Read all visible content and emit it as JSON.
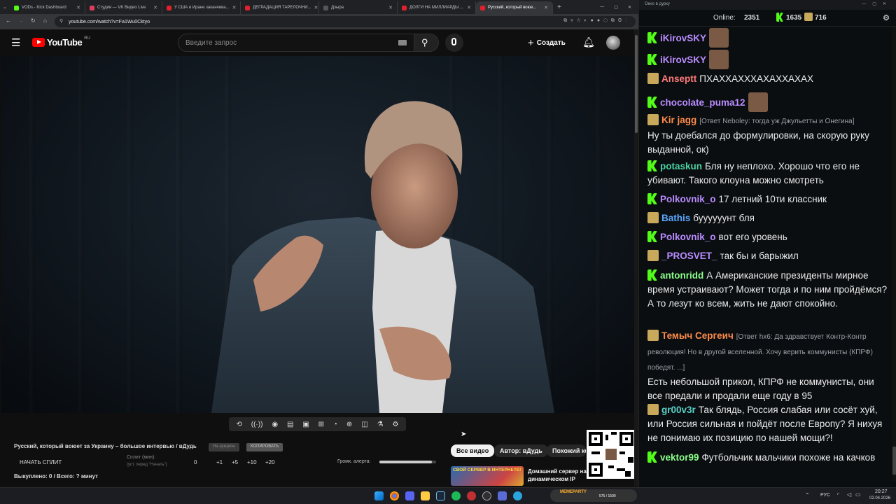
{
  "browser": {
    "tabs": [
      {
        "label": "VODs - Kick Dashboard",
        "color": "#53fc18"
      },
      {
        "label": "Студия — VK Видео Live",
        "color": "#e03c5c"
      },
      {
        "label": "У США в Иране заканчива...",
        "color": "#e0202c"
      },
      {
        "label": "ДЕГРАДАЦИЯ ТАРЕЛОЧНИ...",
        "color": "#e0202c"
      },
      {
        "label": "Дзыра",
        "color": "#555555"
      },
      {
        "label": "ДОЛГИ НА МИЛЛИАРДЫ ...",
        "color": "#e0202c"
      },
      {
        "label": "Русский, который воюе...",
        "color": "#e0202c"
      }
    ],
    "new_tab": "+",
    "url": "youtube.com/watch?v=Fa1Wu0Cktyo"
  },
  "youtube": {
    "logo_text": "YouTube",
    "logo_region": "RU",
    "search_placeholder": "Введите запрос",
    "create_label": "Создать"
  },
  "controls": {
    "video_title": "Русский, который воюет за Украину – большое интервью / вДудь",
    "btn_on_auction": "На аукцион",
    "btn_copy": "КОПИРОВАТЬ",
    "start_split": "НАЧАТЬ СПЛИТ",
    "split_label": "Сплит (мин):",
    "split_hint": "(уст. перед \"Начать\")",
    "split_value": "0",
    "increments": [
      "+1",
      "+5",
      "+10",
      "+20"
    ],
    "alert_volume_label": "Громк. алерта:",
    "alert_volume": 0.92,
    "bought": "Выкуплено: 0 / Всего: ? минут",
    "filter_chips": [
      "Все видео",
      "Автор: вДудь",
      "Похожий ко..."
    ],
    "rec_thumb_text": "СВОЙ СЕРВЕР В ИНТЕРНЕТЕ!",
    "rec_title": "Домашний сервер на динамическом IP бесплатно!..."
  },
  "chat": {
    "window_title": "Окно в дурку",
    "online_label": "Online:",
    "online_count": "2351",
    "kick_count": "1635",
    "other_count": "716",
    "messages": [
      {
        "badge": "kick",
        "user": "iKirovSKY",
        "color": "#b98cff",
        "reply": "",
        "text": "",
        "emote": true
      },
      {
        "badge": "kick",
        "user": "iKirovSKY",
        "color": "#b98cff",
        "reply": "",
        "text": "",
        "emote": true
      },
      {
        "badge": "gold",
        "user": "Anseptt",
        "color": "#ff7a7a",
        "reply": "",
        "text": "ПХАХХАХХХАХАХХАХАХ",
        "emote": false
      },
      {
        "badge": "kick",
        "user": "chocolate_puma12",
        "color": "#b98cff",
        "reply": "",
        "text": "",
        "emote": true
      },
      {
        "badge": "gold",
        "user": "Kir jagg",
        "color": "#ff8c4a",
        "reply": "[Ответ Neboley: тогда уж Джульетты и Онегина]",
        "text": "Ну ты доебался до формулировки, на скорую руку выданной, ок)",
        "emote": false
      },
      {
        "badge": "kick",
        "user": "potaskun",
        "color": "#4ad1a0",
        "reply": "",
        "text": "Бля ну неплохо. Хорошо что его не убивают. Такого клоуна можно смотреть",
        "emote": false
      },
      {
        "badge": "kick",
        "user": "Polkovnik_o",
        "color": "#b98cff",
        "reply": "",
        "text": "17 летний 10ти классник",
        "emote": false
      },
      {
        "badge": "gold",
        "user": "Bathis",
        "color": "#5aa8ff",
        "reply": "",
        "text": "буууууунт бля",
        "emote": false
      },
      {
        "badge": "kick",
        "user": "Polkovnik_o",
        "color": "#b98cff",
        "reply": "",
        "text": "вот его уровень",
        "emote": false
      },
      {
        "badge": "gold",
        "user": "_PROSVET_",
        "color": "#b98cff",
        "reply": "",
        "text": "так бы и барыжил",
        "emote": false
      },
      {
        "badge": "kick",
        "user": "antonridd",
        "color": "#8aff8a",
        "reply": "",
        "text": "А Американские президенты мирное время устраивают? Может тогда и по ним пройдёмся? А то лезут ко всем, жить не дают спокойно.",
        "emote": false
      },
      {
        "badge": "gold",
        "user": "Темыч Сергеич",
        "color": "#ff8c4a",
        "reply": "[Ответ hx6: Да здравствует Контр-Контр революция! Но в другой вселенной. Хочу верить коммунисты (КПРФ) победят. ...]",
        "text": "Есть небольшой прикол, КПРФ не коммунисты, они все предали и продали еще году в 95",
        "emote": false
      },
      {
        "badge": "gold",
        "user": "gr00v3r",
        "color": "#5ad1c8",
        "reply": "",
        "text": "Так блядь, Россия слабая или сосёт хуй, или Россия сильная и пойдёт после Европу? Я нихуя не понимаю их позицию по нашей мощи?!",
        "emote": false
      },
      {
        "badge": "kick",
        "user": "vektor99",
        "color": "#8aff8a",
        "reply": "",
        "text": "Футбольчик мальчики похоже на качков",
        "emote": false
      }
    ]
  },
  "taskbar": {
    "lang": "РУС",
    "time": "20:27",
    "date": "02.04.2026",
    "meme_title": "MEMEPARTY",
    "meme_count": "575 / 1500"
  }
}
